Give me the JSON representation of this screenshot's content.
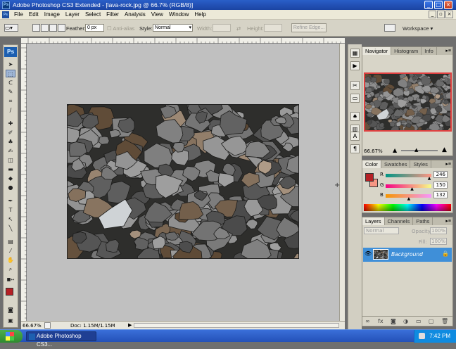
{
  "window": {
    "title": "Adobe Photoshop CS3 Extended - [lava-rock.jpg @ 66.7% (RGB/8)]",
    "minimize": "_",
    "maximize": "□",
    "close": "×"
  },
  "menubar": {
    "items": [
      "File",
      "Edit",
      "Image",
      "Layer",
      "Select",
      "Filter",
      "Analysis",
      "View",
      "Window",
      "Help"
    ]
  },
  "options": {
    "feather_label": "Feather:",
    "feather_value": "0 px",
    "antialias_label": "Anti-alias",
    "style_label": "Style:",
    "style_value": "Normal",
    "width_label": "Width:",
    "height_label": "Height:",
    "refine_label": "Refine Edge...",
    "workspace_label": "Workspace ▾"
  },
  "status": {
    "zoom": "66.67%",
    "doc": "Doc: 1.15M/1.15M"
  },
  "navigator": {
    "tabs": [
      "Navigator",
      "Histogram",
      "Info"
    ],
    "zoom": "66.67%"
  },
  "color_panel": {
    "tabs": [
      "Color",
      "Swatches",
      "Styles"
    ],
    "r_label": "R",
    "g_label": "G",
    "b_label": "B",
    "r_value": "246",
    "g_value": "150",
    "b_value": "132",
    "r": 246,
    "g": 150,
    "b": 132,
    "foreground": "#b52025",
    "background": "#f69684"
  },
  "layers_panel": {
    "tabs": [
      "Layers",
      "Channels",
      "Paths"
    ],
    "blend_mode": "Normal",
    "opacity_label": "Opacity:",
    "opacity_value": "100%",
    "fill_label": "Fill:",
    "fill_value": "100%",
    "layer_name": "Background"
  },
  "taskbar": {
    "task_label": "Adobe Photoshop CS3...",
    "time": "7:42 PM"
  }
}
